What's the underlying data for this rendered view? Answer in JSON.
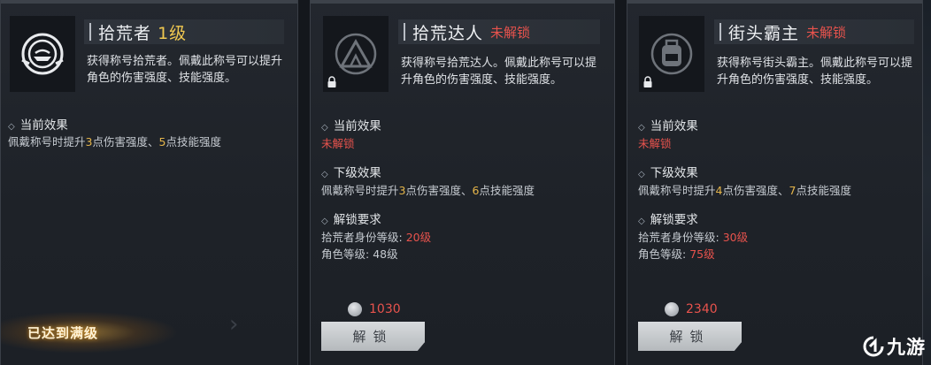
{
  "cards": [
    {
      "title": "拾荒者",
      "title_level": "1级",
      "locked_label": "",
      "description": "获得称号拾荒者。佩戴此称号可以提升角色的伤害强度、技能强度。",
      "icon": "scavenger-emblem-icon",
      "current_effect": {
        "heading": "当前效果",
        "parts": [
          "佩戴称号时提升",
          "3",
          "点伤害强度、",
          "5",
          "点技能强度"
        ]
      },
      "status": "已达到满级"
    },
    {
      "title": "拾荒达人",
      "locked_label": "未解锁",
      "description": "获得称号拾荒达人。佩戴此称号可以提升角色的伤害强度、技能强度。",
      "icon": "tent-emblem-icon",
      "current_effect": {
        "heading": "当前效果",
        "value": "未解锁"
      },
      "next_effect": {
        "heading": "下级效果",
        "parts": [
          "佩戴称号时提升",
          "3",
          "点伤害强度、",
          "6",
          "点技能强度"
        ]
      },
      "requirements": {
        "heading": "解锁要求",
        "identity_label": "拾荒者身份等级:",
        "identity_value": "20级",
        "role_label": "角色等级:",
        "role_value": "48级"
      },
      "cost": "1030",
      "button": "解锁"
    },
    {
      "title": "街头霸主",
      "locked_label": "未解锁",
      "description": "获得称号街头霸主。佩戴此称号可以提升角色的伤害强度、技能强度。",
      "icon": "backpack-emblem-icon",
      "current_effect": {
        "heading": "当前效果",
        "value": "未解锁"
      },
      "next_effect": {
        "heading": "下级效果",
        "parts": [
          "佩戴称号时提升",
          "4",
          "点伤害强度、",
          "7",
          "点技能强度"
        ]
      },
      "requirements": {
        "heading": "解锁要求",
        "identity_label": "拾荒者身份等级:",
        "identity_value": "30级",
        "role_label": "角色等级:",
        "role_value": "75级"
      },
      "cost": "2340",
      "button": "解锁"
    }
  ],
  "watermark": "九游",
  "colors": {
    "locked_red": "#e8534d",
    "highlight_gold": "#e5b54a",
    "level_gold": "#f0c850"
  }
}
